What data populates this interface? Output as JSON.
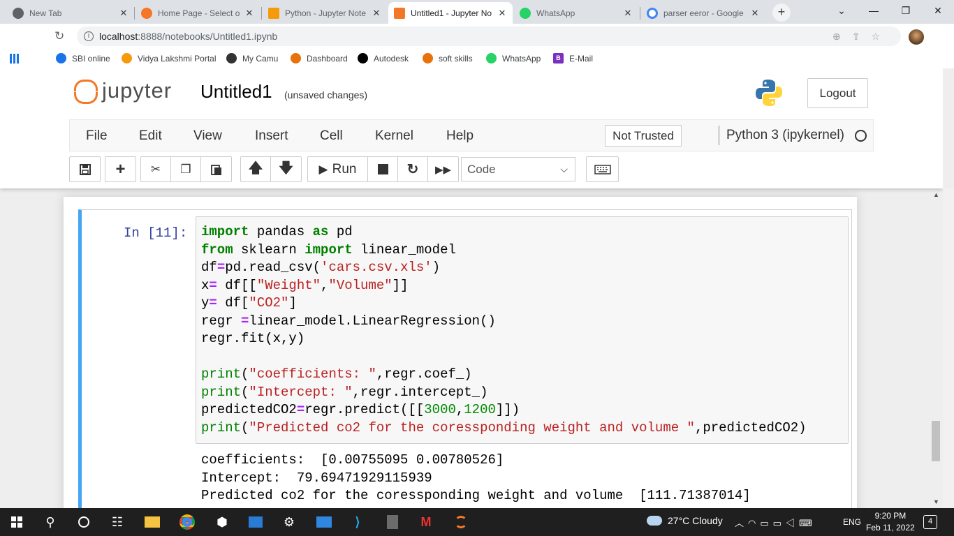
{
  "browser": {
    "tabs": [
      {
        "title": "New Tab",
        "favicon_color": "#5f6368"
      },
      {
        "title": "Home Page - Select o",
        "favicon_color": "#f37726"
      },
      {
        "title": "Python - Jupyter Note",
        "favicon_color": "#f59b0b"
      },
      {
        "title": "Untitled1 - Jupyter No",
        "favicon_color": "#f37726"
      },
      {
        "title": "WhatsApp",
        "favicon_color": "#25d366"
      },
      {
        "title": "parser eeror - Google",
        "favicon_color": "#4285f4"
      }
    ],
    "new_tab_symbol": "+",
    "url_host": "localhost",
    "url_path": ":8888/notebooks/Untitled1.ipynb",
    "bookmarks": [
      {
        "label": "SBI online",
        "icon_color": "#1a73e8"
      },
      {
        "label": "Vidya Lakshmi Portal",
        "icon_color": "#f59b0b"
      },
      {
        "label": "My Camu",
        "icon_color": "#333333"
      },
      {
        "label": "Dashboard",
        "icon_color": "#e8710a"
      },
      {
        "label": "Autodesk",
        "icon_color": "#000000"
      },
      {
        "label": "soft skills",
        "icon_color": "#e8710a"
      },
      {
        "label": "WhatsApp",
        "icon_color": "#25d366"
      },
      {
        "label": "E-Mail",
        "icon_color": "#7b2fbe",
        "badge": "B"
      }
    ]
  },
  "jupyter": {
    "logo_text": "jupyter",
    "notebook_title": "Untitled1",
    "save_status": "(unsaved changes)",
    "logout_label": "Logout",
    "menu": [
      "File",
      "Edit",
      "View",
      "Insert",
      "Cell",
      "Kernel",
      "Help"
    ],
    "trust_label": "Not Trusted",
    "kernel_name": "Python 3 (ipykernel)",
    "run_label": "Run",
    "cell_type": "Code",
    "accent_color": "#42a5f5"
  },
  "cell": {
    "prompt": "In [11]:",
    "code_lines": [
      [
        {
          "t": "import",
          "c": "kw"
        },
        {
          "t": " pandas "
        },
        {
          "t": "as",
          "c": "kw"
        },
        {
          "t": " pd"
        }
      ],
      [
        {
          "t": "from",
          "c": "kw"
        },
        {
          "t": " sklearn "
        },
        {
          "t": "import",
          "c": "kw"
        },
        {
          "t": " linear_model"
        }
      ],
      [
        {
          "t": "df"
        },
        {
          "t": "=",
          "c": "op"
        },
        {
          "t": "pd.read_csv("
        },
        {
          "t": "'cars.csv.xls'",
          "c": "str"
        },
        {
          "t": ")"
        }
      ],
      [
        {
          "t": "x"
        },
        {
          "t": "=",
          "c": "op"
        },
        {
          "t": " df[["
        },
        {
          "t": "\"Weight\"",
          "c": "str"
        },
        {
          "t": ","
        },
        {
          "t": "\"Volume\"",
          "c": "str"
        },
        {
          "t": "]]"
        }
      ],
      [
        {
          "t": "y"
        },
        {
          "t": "=",
          "c": "op"
        },
        {
          "t": " df["
        },
        {
          "t": "\"CO2\"",
          "c": "str"
        },
        {
          "t": "]"
        }
      ],
      [
        {
          "t": "regr "
        },
        {
          "t": "=",
          "c": "op"
        },
        {
          "t": "linear_model.LinearRegression()"
        }
      ],
      [
        {
          "t": "regr.fit(x,y)"
        }
      ],
      [],
      [
        {
          "t": "print",
          "c": "bi2"
        },
        {
          "t": "("
        },
        {
          "t": "\"coefficients: \"",
          "c": "str"
        },
        {
          "t": ",regr.coef_)"
        }
      ],
      [
        {
          "t": "print",
          "c": "bi2"
        },
        {
          "t": "("
        },
        {
          "t": "\"Intercept: \"",
          "c": "str"
        },
        {
          "t": ",regr.intercept_)"
        }
      ],
      [
        {
          "t": "predictedCO2"
        },
        {
          "t": "=",
          "c": "op"
        },
        {
          "t": "regr.predict([["
        },
        {
          "t": "3000",
          "c": "num"
        },
        {
          "t": ","
        },
        {
          "t": "1200",
          "c": "num"
        },
        {
          "t": "]])"
        }
      ],
      [
        {
          "t": "print",
          "c": "bi2"
        },
        {
          "t": "("
        },
        {
          "t": "\"Predicted co2 for the coressponding weight and volume \"",
          "c": "str"
        },
        {
          "t": ",predictedCO2)"
        }
      ]
    ],
    "output_lines": [
      "coefficients:  [0.00755095 0.00780526]",
      "Intercept:  79.69471929115939",
      "Predicted co2 for the coressponding weight and volume  [111.71387014]"
    ]
  },
  "taskbar": {
    "weather": "27°C  Cloudy",
    "language": "ENG",
    "time": "9:20 PM",
    "date": "Feb 11, 2022",
    "notifications": "4"
  }
}
